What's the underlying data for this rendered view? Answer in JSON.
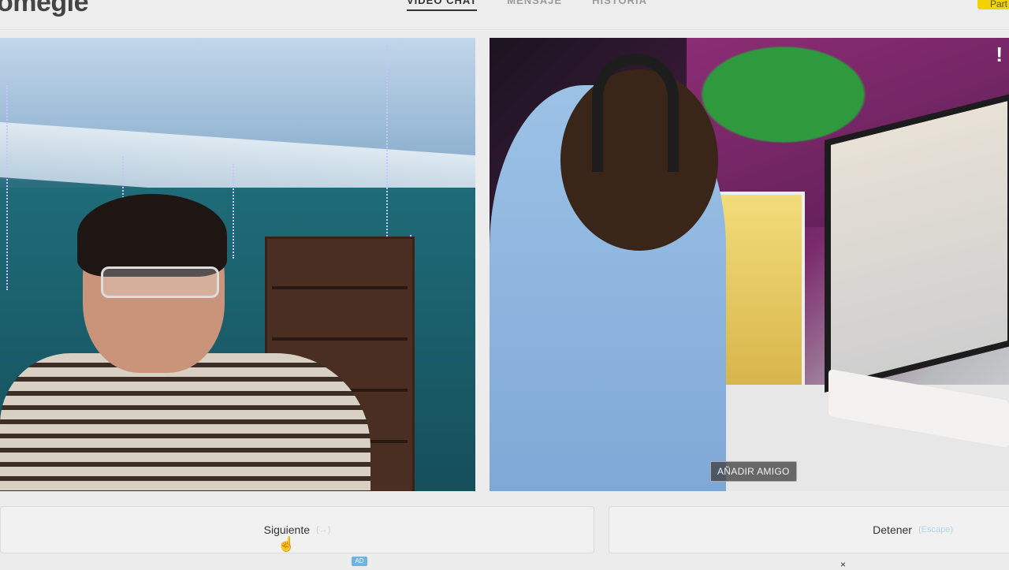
{
  "header": {
    "logo_text": "omegle",
    "nav": [
      {
        "label": "VIDEO CHAT",
        "active": true
      },
      {
        "label": "MENSAJE",
        "active": false
      },
      {
        "label": "HISTORIA",
        "active": false
      }
    ],
    "join_label": "Part",
    "accent_color": "#f2d200"
  },
  "video_left": {
    "description_icon": "webcam-feed"
  },
  "video_right": {
    "report_icon": "exclamation-icon",
    "add_friend_label": "AÑADIR AMIGO"
  },
  "controls": {
    "next_label": "Siguiente",
    "next_hint": "(→)",
    "stop_label": "Detener",
    "stop_hint": "(Escape)"
  },
  "ad": {
    "badge": "AD",
    "close": "×"
  }
}
